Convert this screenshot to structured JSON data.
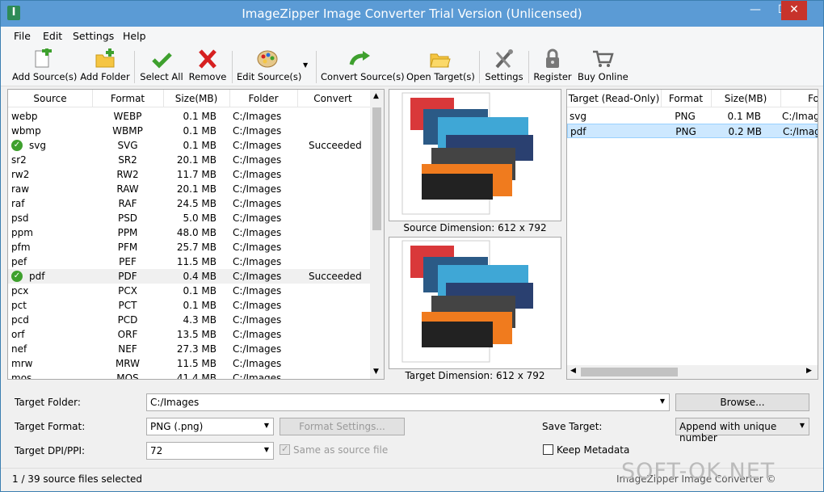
{
  "window": {
    "title": "ImageZipper Image Converter Trial Version (Unlicensed)"
  },
  "menu": [
    "File",
    "Edit",
    "Settings",
    "Help"
  ],
  "toolbar": {
    "add_sources": "Add Source(s)",
    "add_folder": "Add Folder",
    "select_all": "Select All",
    "remove": "Remove",
    "edit_sources": "Edit Source(s)",
    "convert_sources": "Convert Source(s)",
    "open_target": "Open Target(s)",
    "settings": "Settings",
    "register": "Register",
    "buy_online": "Buy Online"
  },
  "source_list": {
    "columns": [
      "Source",
      "Format",
      "Size(MB)",
      "Folder",
      "Convert"
    ],
    "rows": [
      {
        "source": "webp",
        "format": "WEBP",
        "size": "0.1 MB",
        "folder": "C:/Images",
        "convert": ""
      },
      {
        "source": "wbmp",
        "format": "WBMP",
        "size": "0.1 MB",
        "folder": "C:/Images",
        "convert": ""
      },
      {
        "source": "svg",
        "format": "SVG",
        "size": "0.1 MB",
        "folder": "C:/Images",
        "convert": "Succeeded"
      },
      {
        "source": "sr2",
        "format": "SR2",
        "size": "20.1 MB",
        "folder": "C:/Images",
        "convert": ""
      },
      {
        "source": "rw2",
        "format": "RW2",
        "size": "11.7 MB",
        "folder": "C:/Images",
        "convert": ""
      },
      {
        "source": "raw",
        "format": "RAW",
        "size": "20.1 MB",
        "folder": "C:/Images",
        "convert": ""
      },
      {
        "source": "raf",
        "format": "RAF",
        "size": "24.5 MB",
        "folder": "C:/Images",
        "convert": ""
      },
      {
        "source": "psd",
        "format": "PSD",
        "size": "5.0 MB",
        "folder": "C:/Images",
        "convert": ""
      },
      {
        "source": "ppm",
        "format": "PPM",
        "size": "48.0 MB",
        "folder": "C:/Images",
        "convert": ""
      },
      {
        "source": "pfm",
        "format": "PFM",
        "size": "25.7 MB",
        "folder": "C:/Images",
        "convert": ""
      },
      {
        "source": "pef",
        "format": "PEF",
        "size": "11.5 MB",
        "folder": "C:/Images",
        "convert": ""
      },
      {
        "source": "pdf",
        "format": "PDF",
        "size": "0.4 MB",
        "folder": "C:/Images",
        "convert": "Succeeded"
      },
      {
        "source": "pcx",
        "format": "PCX",
        "size": "0.1 MB",
        "folder": "C:/Images",
        "convert": ""
      },
      {
        "source": "pct",
        "format": "PCT",
        "size": "0.1 MB",
        "folder": "C:/Images",
        "convert": ""
      },
      {
        "source": "pcd",
        "format": "PCD",
        "size": "4.3 MB",
        "folder": "C:/Images",
        "convert": ""
      },
      {
        "source": "orf",
        "format": "ORF",
        "size": "13.5 MB",
        "folder": "C:/Images",
        "convert": ""
      },
      {
        "source": "nef",
        "format": "NEF",
        "size": "27.3 MB",
        "folder": "C:/Images",
        "convert": ""
      },
      {
        "source": "mrw",
        "format": "MRW",
        "size": "11.5 MB",
        "folder": "C:/Images",
        "convert": ""
      },
      {
        "source": "mos",
        "format": "MOS",
        "size": "41.4 MB",
        "folder": "C:/Images",
        "convert": ""
      }
    ]
  },
  "preview": {
    "source_caption": "Source Dimension: 612 x 792",
    "target_caption": "Target Dimension: 612 x 792"
  },
  "target_list": {
    "columns": [
      "Target (Read-Only)",
      "Format",
      "Size(MB)",
      "Fo"
    ],
    "rows": [
      {
        "target": "svg",
        "format": "PNG",
        "size": "0.1 MB",
        "folder": "C:/Imag"
      },
      {
        "target": "pdf",
        "format": "PNG",
        "size": "0.2 MB",
        "folder": "C:/Imag"
      }
    ]
  },
  "form": {
    "target_folder_label": "Target Folder:",
    "target_folder_value": "C:/Images",
    "browse": "Browse...",
    "target_format_label": "Target Format:",
    "target_format_value": "PNG (.png)",
    "format_settings": "Format Settings...",
    "save_target_label": "Save Target:",
    "save_target_value": "Append with unique number",
    "dpi_label": "Target DPI/PPI:",
    "dpi_value": "72",
    "same_as_source": "Same as source file",
    "keep_metadata": "Keep Metadata"
  },
  "status": {
    "selection": "1 / 39 source files selected",
    "right": "ImageZipper Image Converter ©",
    "watermark": "SOFT-OK.NET"
  },
  "colors": {
    "titlebar": "#5b9bd5",
    "close": "#c7332b",
    "selection": "#cde8ff",
    "success": "#3ea02e"
  }
}
